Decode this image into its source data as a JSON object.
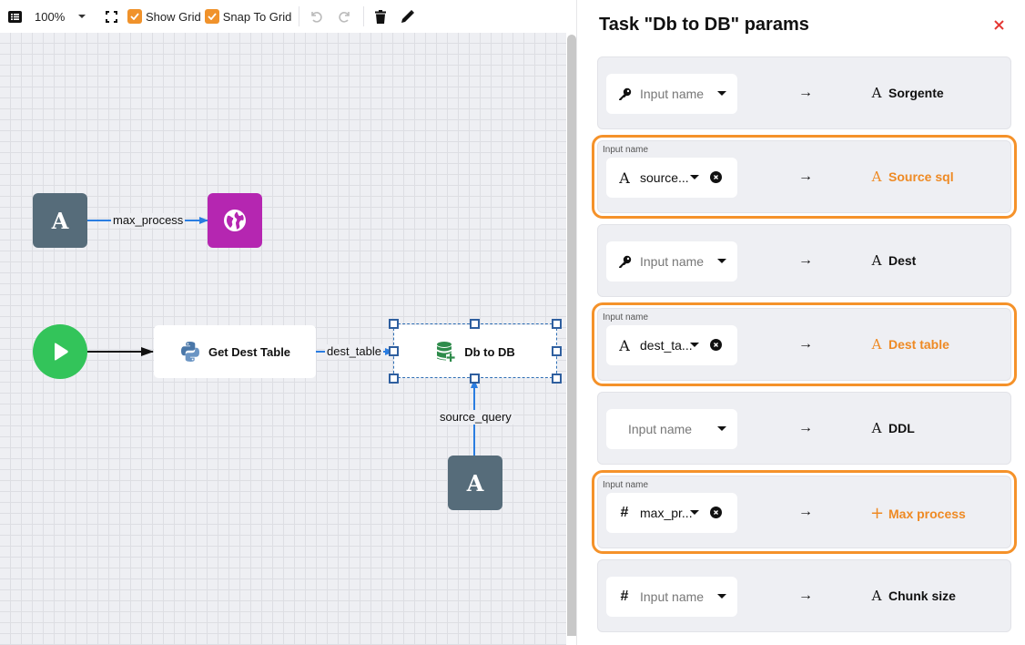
{
  "toolbar": {
    "menu_icon": "list-icon",
    "zoom_level": "100%",
    "fit_icon": "fullscreen-icon",
    "show_grid": {
      "label": "Show Grid",
      "checked": true
    },
    "snap_to_grid": {
      "label": "Snap To Grid",
      "checked": true
    },
    "undo_icon": "undo-icon",
    "redo_icon": "redo-icon",
    "delete_icon": "trash-icon",
    "edit_icon": "pencil-icon"
  },
  "canvas": {
    "nodes": [
      {
        "id": "str1",
        "type": "string-input",
        "icon": "A"
      },
      {
        "id": "web",
        "type": "web-task",
        "icon": "globe-icon"
      },
      {
        "id": "start",
        "type": "start",
        "icon": "play-icon"
      },
      {
        "id": "getdest",
        "type": "python-task",
        "label": "Get Dest Table",
        "icon": "python-icon"
      },
      {
        "id": "dbtodb",
        "type": "db-task",
        "label": "Db to DB",
        "icon": "database-add-icon",
        "selected": true
      },
      {
        "id": "str2",
        "type": "string-input",
        "icon": "A"
      }
    ],
    "edges": [
      {
        "from": "str1",
        "to": "web",
        "label": "max_process"
      },
      {
        "from": "start",
        "to": "getdest",
        "label": ""
      },
      {
        "from": "getdest",
        "to": "dbtodb",
        "label": "dest_table"
      },
      {
        "from": "str2",
        "to": "dbtodb",
        "label": "source_query"
      }
    ]
  },
  "panel": {
    "title": "Task \"Db to DB\" params",
    "close_icon": "close-icon",
    "accent_color": "#ee8a24",
    "params": [
      {
        "caption": "",
        "input_icon": "key-icon",
        "input_glyph": "",
        "value": "",
        "placeholder": "Input name",
        "has_clear": false,
        "arrow": "→",
        "target_icon": "A",
        "target": "Sorgente",
        "highlighted": false
      },
      {
        "caption": "Input name",
        "input_icon": "string-icon",
        "input_glyph": "A",
        "value": "source...",
        "placeholder": "",
        "has_clear": true,
        "arrow": "→",
        "target_icon": "A",
        "target": "Source sql",
        "highlighted": true
      },
      {
        "caption": "",
        "input_icon": "key-icon",
        "input_glyph": "",
        "value": "",
        "placeholder": "Input name",
        "has_clear": false,
        "arrow": "→",
        "target_icon": "A",
        "target": "Dest",
        "highlighted": false
      },
      {
        "caption": "Input name",
        "input_icon": "string-icon",
        "input_glyph": "A",
        "value": "dest_ta...",
        "placeholder": "",
        "has_clear": true,
        "arrow": "→",
        "target_icon": "A",
        "target": "Dest table",
        "highlighted": true
      },
      {
        "caption": "",
        "input_icon": "",
        "input_glyph": "",
        "value": "",
        "placeholder": "Input name",
        "has_clear": false,
        "arrow": "→",
        "target_icon": "A",
        "target": "DDL",
        "highlighted": false
      },
      {
        "caption": "Input name",
        "input_icon": "number-icon",
        "input_glyph": "#",
        "value": "max_pr...",
        "placeholder": "",
        "has_clear": true,
        "arrow": "→",
        "target_icon": "+",
        "target": "Max process",
        "highlighted": true
      },
      {
        "caption": "",
        "input_icon": "number-icon",
        "input_glyph": "#",
        "value": "",
        "placeholder": "Input name",
        "has_clear": false,
        "arrow": "→",
        "target_icon": "A",
        "target": "Chunk size",
        "highlighted": false
      }
    ]
  }
}
